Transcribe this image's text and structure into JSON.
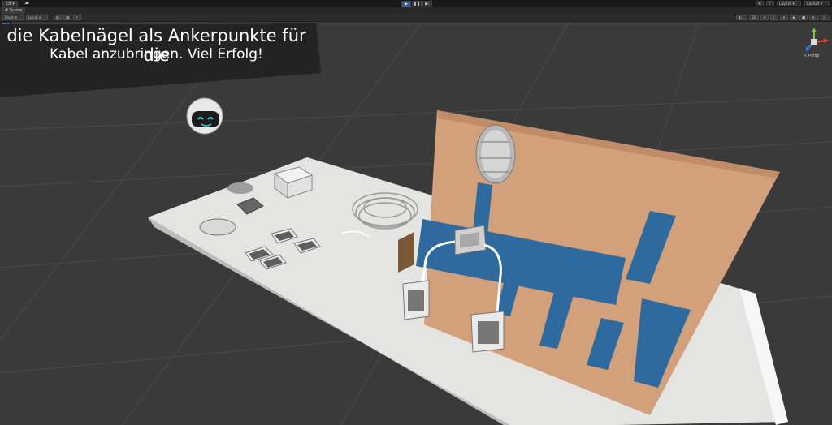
{
  "app": {
    "account_label": "EB",
    "scene_tab": "Scene"
  },
  "toolbar": {
    "pivot": "Pivot",
    "local": "Local",
    "layers": "Layers",
    "layout": "Layout",
    "zoom_label": "3D"
  },
  "scene": {
    "persp_label": "< Persp"
  },
  "banner": {
    "line1": "die Kabelnägel als Ankerpunkte für die",
    "line2": "Kabel anzubringen. Viel Erfolg!"
  },
  "colors": {
    "background": "#3a3a3a",
    "board": "#d2a07a",
    "channel": "#2f6a9e",
    "table": "#e4e4e2",
    "banner": "#232323"
  },
  "icons": {
    "play": "play-icon",
    "pause": "pause-icon",
    "step": "step-icon",
    "cloud": "cloud-icon"
  }
}
